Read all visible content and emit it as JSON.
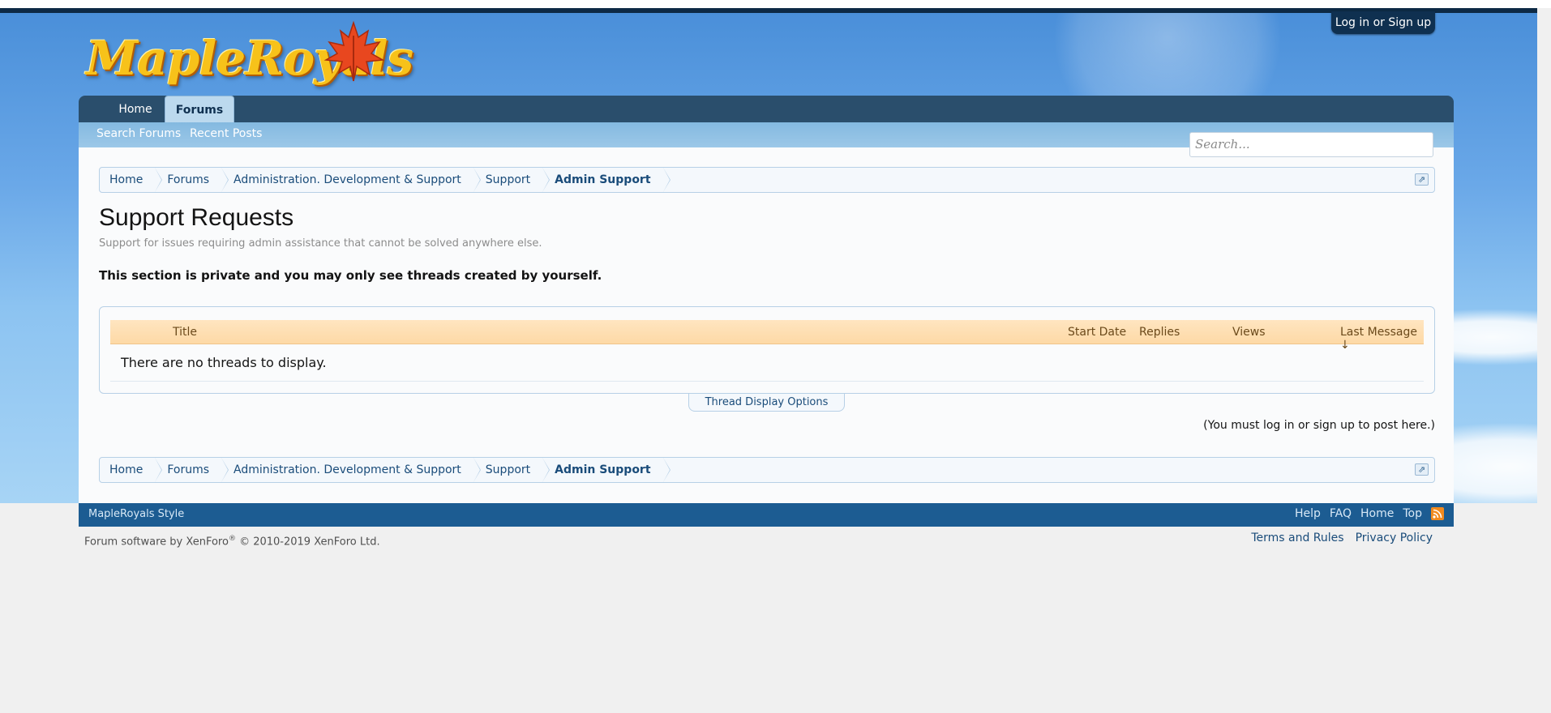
{
  "header": {
    "logo_text": "MapleRoyals",
    "login_label": "Log in or Sign up"
  },
  "nav": {
    "tabs": [
      {
        "label": "Home",
        "active": false
      },
      {
        "label": "Forums",
        "active": true
      }
    ],
    "subnav": [
      "Search Forums",
      "Recent Posts"
    ],
    "search_placeholder": "Search..."
  },
  "breadcrumb": {
    "items": [
      "Home",
      "Forums",
      "Administration. Development & Support",
      "Support",
      "Admin Support"
    ]
  },
  "page": {
    "title": "Support Requests",
    "description": "Support for issues requiring admin assistance that cannot be solved anywhere else.",
    "private_note": "This section is private and you may only see threads created by yourself."
  },
  "threads": {
    "columns": {
      "title": "Title",
      "start_date": "Start Date",
      "replies": "Replies",
      "views": "Views",
      "last_message": "Last Message ↓"
    },
    "empty_message": "There are no threads to display.",
    "display_options": "Thread Display Options",
    "must_login": "(You must log in or sign up to post here.)"
  },
  "footer": {
    "style_name": "MapleRoyals Style",
    "links": [
      "Help",
      "FAQ",
      "Home",
      "Top"
    ],
    "copyright": "Forum software by XenForo",
    "copyright_mark": "®",
    "copyright_rest": " © 2010-2019 XenForo Ltd.",
    "legal": [
      "Terms and Rules",
      "Privacy Policy"
    ]
  },
  "colors": {
    "nav_dark": "#2a4e6c",
    "footer_blue": "#1c5c92",
    "thread_header": "#ffe5c0",
    "link_blue": "#1a4c7a"
  }
}
